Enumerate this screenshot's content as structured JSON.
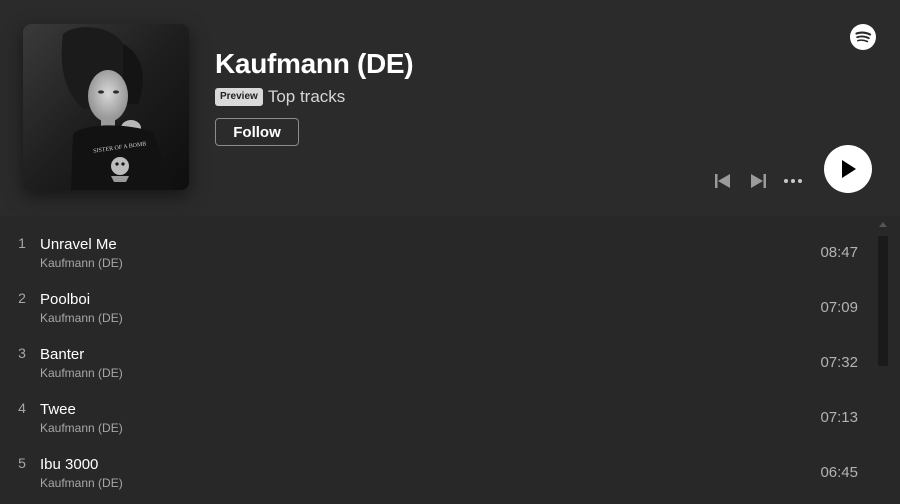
{
  "header": {
    "artist_name": "Kaufmann (DE)",
    "preview_badge": "Preview",
    "subtitle": "Top tracks",
    "follow_label": "Follow",
    "cover_text": "SISTER OF A BOMB"
  },
  "icons": {
    "logo": "spotify-logo-icon",
    "previous": "skip-previous-icon",
    "next": "skip-next-icon",
    "more": "more-options-icon",
    "play": "play-icon"
  },
  "colors": {
    "background": "#282828",
    "header_background": "#2b2b2b",
    "text_primary": "#ffffff",
    "text_secondary": "#a7a7a7"
  },
  "tracks": [
    {
      "number": "1",
      "title": "Unravel Me",
      "artist": "Kaufmann (DE)",
      "duration": "08:47"
    },
    {
      "number": "2",
      "title": "Poolboi",
      "artist": "Kaufmann (DE)",
      "duration": "07:09"
    },
    {
      "number": "3",
      "title": "Banter",
      "artist": "Kaufmann (DE)",
      "duration": "07:32"
    },
    {
      "number": "4",
      "title": "Twee",
      "artist": "Kaufmann (DE)",
      "duration": "07:13"
    },
    {
      "number": "5",
      "title": "Ibu 3000",
      "artist": "Kaufmann (DE)",
      "duration": "06:45"
    }
  ]
}
